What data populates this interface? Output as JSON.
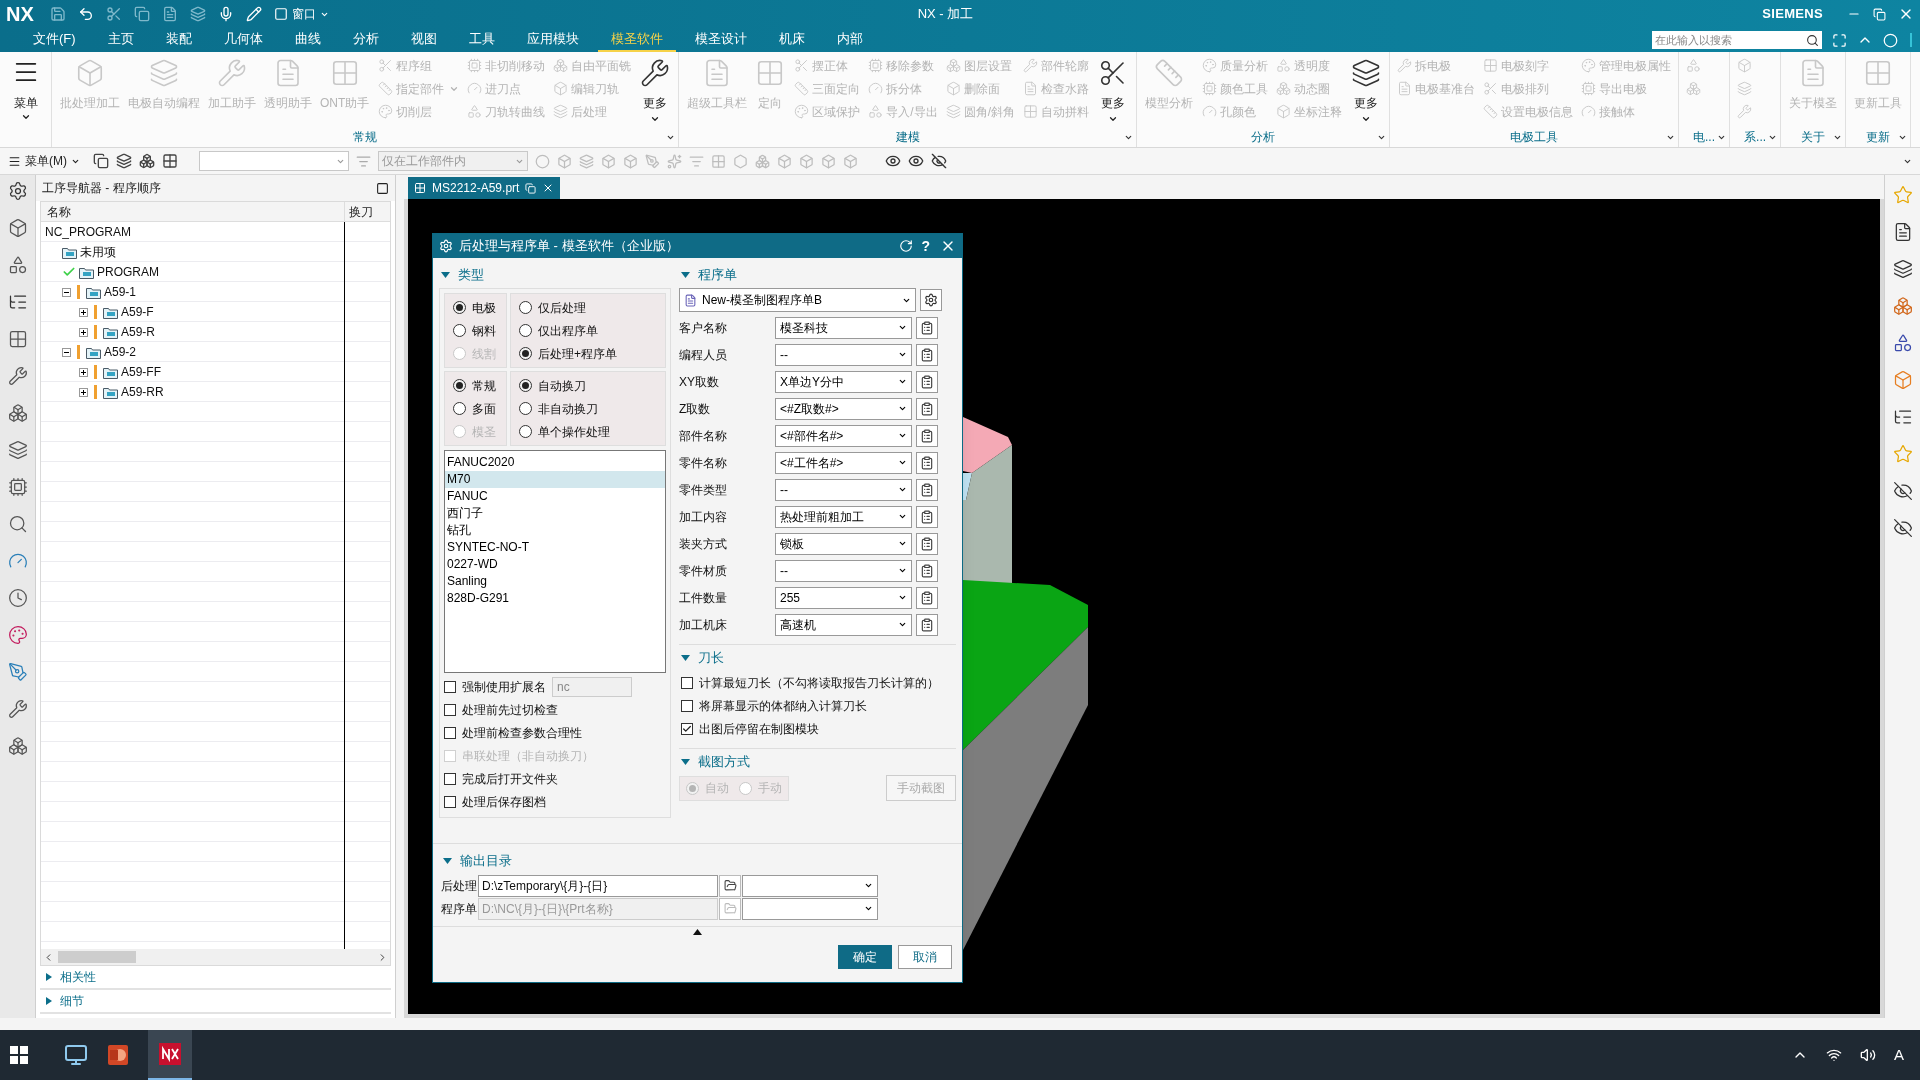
{
  "title_bar": {
    "logo": "NX",
    "window_menu": "窗口",
    "title": "NX - 加工",
    "brand": "SIEMENS"
  },
  "menu_tabs": [
    {
      "label": "文件(F)",
      "selected": false
    },
    {
      "label": "主页",
      "selected": false
    },
    {
      "label": "装配",
      "selected": false
    },
    {
      "label": "几何体",
      "selected": false
    },
    {
      "label": "曲线",
      "selected": false
    },
    {
      "label": "分析",
      "selected": false
    },
    {
      "label": "视图",
      "selected": false
    },
    {
      "label": "工具",
      "selected": false
    },
    {
      "label": "应用模块",
      "selected": false
    },
    {
      "label": "模圣软件",
      "selected": true
    },
    {
      "label": "模圣设计",
      "selected": false
    },
    {
      "label": "机床",
      "selected": false
    },
    {
      "label": "内部",
      "selected": false
    }
  ],
  "search": {
    "placeholder": "在此输入以搜索"
  },
  "ribbon": {
    "menu_button": "菜单",
    "groups": [
      {
        "label": "常规",
        "columns": [
          {
            "kind": "large",
            "items": [
              {
                "label": "批处理加工",
                "disabled": true
              },
              {
                "label": "电极自动编程",
                "disabled": true
              },
              {
                "label": "加工助手",
                "disabled": true
              },
              {
                "label": "透明助手",
                "disabled": true
              },
              {
                "label": "ONT助手",
                "disabled": true
              }
            ]
          },
          {
            "kind": "small",
            "items": [
              {
                "label": "程序组",
                "disabled": true
              },
              {
                "label": "指定部件",
                "disabled": true,
                "dropdown": true
              },
              {
                "label": "切削层",
                "disabled": true
              }
            ]
          },
          {
            "kind": "small",
            "items": [
              {
                "label": "非切削移动",
                "disabled": true
              },
              {
                "label": "进刀点",
                "disabled": true
              },
              {
                "label": "刀轨转曲线",
                "disabled": true
              }
            ]
          },
          {
            "kind": "small",
            "items": [
              {
                "label": "自由平面铣",
                "disabled": true
              },
              {
                "label": "编辑刀轨",
                "disabled": true
              },
              {
                "label": "后处理",
                "disabled": true
              }
            ]
          },
          {
            "kind": "large",
            "items": [
              {
                "label": "更多",
                "disabled": false,
                "dropdown": true
              }
            ]
          }
        ]
      },
      {
        "label": "建模",
        "columns": [
          {
            "kind": "large",
            "items": [
              {
                "label": "超级工具栏",
                "disabled": true
              },
              {
                "label": "定向",
                "disabled": true
              }
            ]
          },
          {
            "kind": "small",
            "items": [
              {
                "label": "摆正体",
                "disabled": true
              },
              {
                "label": "三面定向",
                "disabled": true
              },
              {
                "label": "区域保护",
                "disabled": true
              }
            ]
          },
          {
            "kind": "small",
            "items": [
              {
                "label": "移除参数",
                "disabled": true
              },
              {
                "label": "拆分体",
                "disabled": true
              },
              {
                "label": "导入/导出",
                "disabled": true
              }
            ]
          },
          {
            "kind": "small",
            "items": [
              {
                "label": "图层设置",
                "disabled": true
              },
              {
                "label": "删除面",
                "disabled": true
              },
              {
                "label": "圆角/斜角",
                "disabled": true
              }
            ]
          },
          {
            "kind": "small",
            "items": [
              {
                "label": "部件轮廓",
                "disabled": true
              },
              {
                "label": "检查水路",
                "disabled": true
              },
              {
                "label": "自动拼料",
                "disabled": true
              }
            ]
          },
          {
            "kind": "large",
            "items": [
              {
                "label": "更多",
                "disabled": false,
                "dropdown": true
              }
            ]
          }
        ]
      },
      {
        "label": "分析",
        "columns": [
          {
            "kind": "large",
            "items": [
              {
                "label": "模型分析",
                "disabled": true
              }
            ]
          },
          {
            "kind": "small",
            "items": [
              {
                "label": "质量分析",
                "disabled": true
              },
              {
                "label": "颜色工具",
                "disabled": true
              },
              {
                "label": "孔颜色",
                "disabled": true
              }
            ]
          },
          {
            "kind": "small",
            "items": [
              {
                "label": "透明度",
                "disabled": true
              },
              {
                "label": "动态圈",
                "disabled": true
              },
              {
                "label": "坐标注释",
                "disabled": true
              }
            ]
          },
          {
            "kind": "large",
            "items": [
              {
                "label": "更多",
                "disabled": false,
                "dropdown": true
              }
            ]
          }
        ]
      },
      {
        "label": "电极工具",
        "columns": [
          {
            "kind": "small",
            "items": [
              {
                "label": "拆电极",
                "disabled": true
              },
              {
                "label": "电极基准台",
                "disabled": true
              }
            ]
          },
          {
            "kind": "small",
            "items": [
              {
                "label": "电极刻字",
                "disabled": true
              },
              {
                "label": "电极排列",
                "disabled": true
              },
              {
                "label": "设置电极信息",
                "disabled": true
              }
            ]
          },
          {
            "kind": "small",
            "items": [
              {
                "label": "管理电极属性",
                "disabled": true
              },
              {
                "label": "导出电极",
                "disabled": true
              },
              {
                "label": "接触体",
                "disabled": true
              }
            ]
          }
        ]
      },
      {
        "label": "电...",
        "columns": [
          {
            "kind": "small",
            "items": [
              {
                "disabled": true
              },
              {
                "disabled": true
              }
            ]
          }
        ]
      },
      {
        "label": "系...",
        "columns": [
          {
            "kind": "small",
            "items": [
              {
                "disabled": true
              },
              {
                "disabled": true
              },
              {
                "disabled": true
              }
            ]
          }
        ]
      },
      {
        "label": "关于",
        "columns": [
          {
            "kind": "large",
            "items": [
              {
                "label": "关于模圣",
                "disabled": true
              }
            ]
          }
        ]
      },
      {
        "label": "更新",
        "columns": [
          {
            "kind": "large",
            "items": [
              {
                "label": "更新工具",
                "disabled": true
              }
            ]
          }
        ]
      }
    ]
  },
  "toolbar": {
    "menu": "菜单(M)",
    "filter_combo": "仅在工作部件内"
  },
  "navigator": {
    "title": "工序导航器 - 程序顺序",
    "columns": [
      "名称",
      "换刀"
    ],
    "tree": [
      {
        "label": "NC_PROGRAM",
        "kind": "root",
        "children": [
          {
            "label": "未用项",
            "kind": "group"
          },
          {
            "label": "PROGRAM",
            "kind": "done"
          },
          {
            "label": "A59-1",
            "kind": "pending",
            "expanded": true,
            "children": [
              {
                "label": "A59-F",
                "kind": "pending",
                "expanded": false
              },
              {
                "label": "A59-R",
                "kind": "pending",
                "expanded": false
              }
            ]
          },
          {
            "label": "A59-2",
            "kind": "pending",
            "expanded": true,
            "children": [
              {
                "label": "A59-FF",
                "kind": "pending",
                "expanded": false
              },
              {
                "label": "A59-RR",
                "kind": "pending",
                "expanded": false
              }
            ]
          }
        ]
      }
    ],
    "sections": [
      {
        "label": "相关性",
        "expanded": false
      },
      {
        "label": "细节",
        "expanded": false
      }
    ]
  },
  "graphics": {
    "tab": "MS2212-A59.prt"
  },
  "dialog": {
    "title": "后处理与程序单 - 模圣软件（企业版）",
    "help": "?",
    "type_section": {
      "label": "类型",
      "expanded": true,
      "radio_groups": [
        [
          {
            "label": "电极",
            "selected": true,
            "disabled": false
          },
          {
            "label": "钢料",
            "selected": false,
            "disabled": false
          },
          {
            "label": "线割",
            "selected": false,
            "disabled": true
          }
        ],
        [
          {
            "label": "仅后处理",
            "selected": false,
            "disabled": false
          },
          {
            "label": "仅出程序单",
            "selected": false,
            "disabled": false
          },
          {
            "label": "后处理+程序单",
            "selected": true,
            "disabled": false
          }
        ],
        [
          {
            "label": "常规",
            "selected": true,
            "disabled": false
          },
          {
            "label": "多面",
            "selected": false,
            "disabled": false
          },
          {
            "label": "模圣",
            "selected": false,
            "disabled": true
          }
        ],
        [
          {
            "label": "自动换刀",
            "selected": true,
            "disabled": false
          },
          {
            "label": "非自动换刀",
            "selected": false,
            "disabled": false
          },
          {
            "label": "单个操作处理",
            "selected": false,
            "disabled": false
          }
        ]
      ],
      "post_list": [
        {
          "label": "FANUC2020",
          "selected": false
        },
        {
          "label": "M70",
          "selected": true
        },
        {
          "label": "FANUC",
          "selected": false
        },
        {
          "label": "西门子",
          "selected": false
        },
        {
          "label": "钻孔",
          "selected": false
        },
        {
          "label": "SYNTEC-NO-T",
          "selected": false
        },
        {
          "label": "0227-WD",
          "selected": false
        },
        {
          "label": "Sanling",
          "selected": false
        },
        {
          "label": "828D-G291",
          "selected": false
        }
      ],
      "options": [
        {
          "label": "强制使用扩展名",
          "checked": false,
          "disabled": false,
          "value": "nc"
        },
        {
          "label": "处理前先过切检查",
          "checked": false,
          "disabled": false
        },
        {
          "label": "处理前检查参数合理性",
          "checked": false,
          "disabled": false
        },
        {
          "label": "串联处理（非自动换刀）",
          "checked": false,
          "disabled": true
        },
        {
          "label": "完成后打开文件夹",
          "checked": false,
          "disabled": false
        },
        {
          "label": "处理后保存图档",
          "checked": false,
          "disabled": false
        }
      ]
    },
    "program_section": {
      "label": "程序单",
      "expanded": true,
      "template": "New-模圣制图程序单B",
      "fields": [
        {
          "label": "客户名称",
          "value": "模圣科技"
        },
        {
          "label": "编程人员",
          "value": "--"
        },
        {
          "label": "XY取数",
          "value": "X单边Y分中"
        },
        {
          "label": "Z取数",
          "value": "<#Z取数#>"
        },
        {
          "label": "部件名称",
          "value": "<#部件名#>"
        },
        {
          "label": "零件名称",
          "value": "<#工件名#>"
        },
        {
          "label": "零件类型",
          "value": "--"
        },
        {
          "label": "加工内容",
          "value": "热处理前粗加工"
        },
        {
          "label": "装夹方式",
          "value": "锁板"
        },
        {
          "label": "零件材质",
          "value": "--"
        },
        {
          "label": "工件数量",
          "value": "255"
        },
        {
          "label": "加工机床",
          "value": "高速机"
        }
      ]
    },
    "tool_length_section": {
      "label": "刀长",
      "expanded": true,
      "options": [
        {
          "label": "计算最短刀长（不勾将读取报告刀长计算的）",
          "checked": false,
          "disabled": false
        },
        {
          "label": "将屏幕显示的体都纳入计算刀长",
          "checked": false,
          "disabled": false
        },
        {
          "label": "出图后停留在制图模块",
          "checked": true,
          "disabled": false
        }
      ]
    },
    "capture_section": {
      "label": "截图方式",
      "expanded": true,
      "modes": [
        {
          "label": "自动",
          "selected": true,
          "disabled": true
        },
        {
          "label": "手动",
          "selected": false,
          "disabled": true
        }
      ],
      "button": "手动截图",
      "button_disabled": true
    },
    "output_section": {
      "label": "输出目录",
      "expanded": true,
      "rows": [
        {
          "label": "后处理",
          "value": "D:\\zTemporary\\{月}-{日}",
          "disabled": false
        },
        {
          "label": "程序单",
          "value": "D:\\NC\\{月}-{日}\\{Prt名称}",
          "disabled": true
        }
      ]
    },
    "buttons": [
      {
        "label": "确定",
        "kind": "primary"
      },
      {
        "label": "取消",
        "kind": "secondary"
      }
    ]
  },
  "taskbar": {
    "input_indicator": "A"
  }
}
